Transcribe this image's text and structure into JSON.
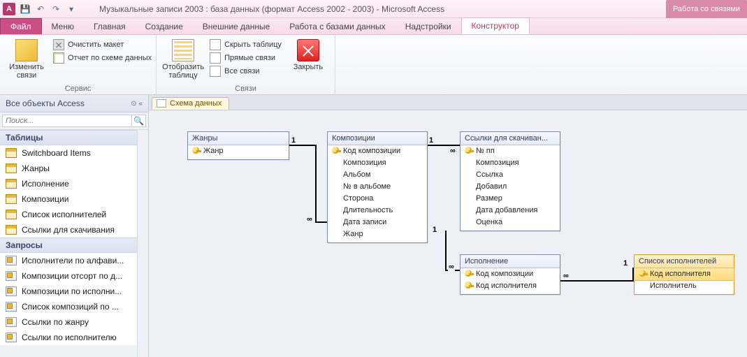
{
  "titlebar": {
    "app_letter": "A",
    "title": "Музыкальные записи 2003 : база данных (формат Access 2002 - 2003)  -  Microsoft Access",
    "context_tab": "Работа со связями"
  },
  "tabs": {
    "file": "Файл",
    "items": [
      "Меню",
      "Главная",
      "Создание",
      "Внешние данные",
      "Работа с базами данных",
      "Надстройки",
      "Конструктор"
    ],
    "active_index": 6
  },
  "ribbon": {
    "group_service": {
      "edit_links": "Изменить связи",
      "clear_layout": "Очистить макет",
      "schema_report": "Отчет по схеме данных",
      "label": "Сервис"
    },
    "group_links": {
      "show_table": "Отобразить таблицу",
      "hide_table": "Скрыть таблицу",
      "direct_links": "Прямые связи",
      "all_links": "Все связи",
      "close": "Закрыть",
      "label": "Связи"
    }
  },
  "nav": {
    "header": "Все объекты Access",
    "search_placeholder": "Поиск...",
    "cat_tables": "Таблицы",
    "tables": [
      "Switchboard Items",
      "Жанры",
      "Исполнение",
      "Композиции",
      "Список исполнителей",
      "Ссылки для скачивания"
    ],
    "cat_queries": "Запросы",
    "queries": [
      "Исполнители по алфави...",
      "Композиции отсорт по д...",
      "Композиции по исполни...",
      "Список композиций  по ...",
      "Ссылки по жанру",
      "Ссылки по исполнителю"
    ]
  },
  "doc_tab": "Схема данных",
  "diagram": {
    "genres": {
      "title": "Жанры",
      "fields": [
        {
          "n": "Жанр",
          "k": true
        }
      ]
    },
    "comps": {
      "title": "Композиции",
      "fields": [
        {
          "n": "Код композиции",
          "k": true
        },
        {
          "n": "Композиция"
        },
        {
          "n": "Альбом"
        },
        {
          "n": "№ в альбоме"
        },
        {
          "n": "Сторона"
        },
        {
          "n": "Длительность"
        },
        {
          "n": "Дата записи"
        },
        {
          "n": "Жанр"
        }
      ]
    },
    "links": {
      "title": "Ссылки для скачиван...",
      "fields": [
        {
          "n": "№ пп",
          "k": true
        },
        {
          "n": "Композиция"
        },
        {
          "n": "Ссылка"
        },
        {
          "n": "Добавил"
        },
        {
          "n": "Размер"
        },
        {
          "n": "Дата добавления"
        },
        {
          "n": "Оценка"
        }
      ]
    },
    "perf": {
      "title": "Исполнение",
      "fields": [
        {
          "n": "Код композиции",
          "k": true
        },
        {
          "n": "Код исполнителя",
          "k": true
        }
      ]
    },
    "artists": {
      "title": "Список исполнителей",
      "fields": [
        {
          "n": "Код исполнителя",
          "k": true,
          "hl": true
        },
        {
          "n": "Исполнитель"
        }
      ]
    }
  },
  "cardinality": {
    "one": "1",
    "many": "∞"
  }
}
